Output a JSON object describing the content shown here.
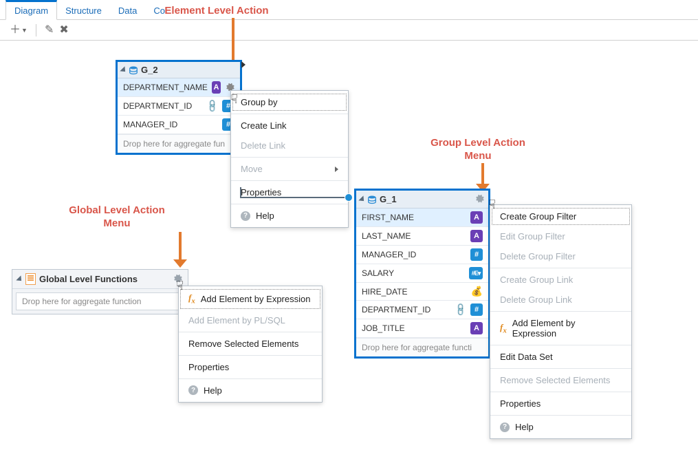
{
  "tabs": {
    "diagram": "Diagram",
    "structure": "Structure",
    "data": "Data",
    "code": "Co"
  },
  "annotations": {
    "element": "Element Level Action",
    "group": "Group Level Action\nMenu",
    "global": "Global Level Action\nMenu"
  },
  "g2": {
    "title": "G_2",
    "fields": [
      {
        "name": "DEPARTMENT_NAME",
        "badge": "A",
        "sel": true,
        "gear": true
      },
      {
        "name": "DEPARTMENT_ID",
        "badge": "H",
        "link": true
      },
      {
        "name": "MANAGER_ID",
        "badge": "H"
      }
    ],
    "drop": "Drop here for aggregate fun"
  },
  "g1": {
    "title": "G_1",
    "fields": [
      {
        "name": "FIRST_NAME",
        "badge": "A",
        "sel": true
      },
      {
        "name": "LAST_NAME",
        "badge": "A"
      },
      {
        "name": "MANAGER_ID",
        "badge": "H"
      },
      {
        "name": "SALARY",
        "badge": "E",
        "ev": true
      },
      {
        "name": "HIRE_DATE",
        "badge": "D"
      },
      {
        "name": "DEPARTMENT_ID",
        "badge": "H",
        "link": true
      },
      {
        "name": "JOB_TITLE",
        "badge": "A"
      }
    ],
    "drop": "Drop here for aggregate functi"
  },
  "global_box": {
    "title": "Global Level Functions",
    "drop": "Drop here for aggregate function"
  },
  "element_menu": {
    "group_by": "Group by",
    "create_link": "Create Link",
    "delete_link": "Delete Link",
    "move": "Move",
    "properties": "Properties",
    "help": "Help"
  },
  "global_menu": {
    "add_expr": "Add Element by Expression",
    "add_plsql": "Add Element by PL/SQL",
    "remove": "Remove Selected Elements",
    "properties": "Properties",
    "help": "Help"
  },
  "group_menu": {
    "create_filter": "Create Group Filter",
    "edit_filter": "Edit Group Filter",
    "delete_filter": "Delete Group Filter",
    "create_link": "Create Group Link",
    "delete_link": "Delete Group Link",
    "add_expr": "Add Element by Expression",
    "edit_ds": "Edit Data Set",
    "remove": "Remove Selected Elements",
    "properties": "Properties",
    "help": "Help"
  }
}
